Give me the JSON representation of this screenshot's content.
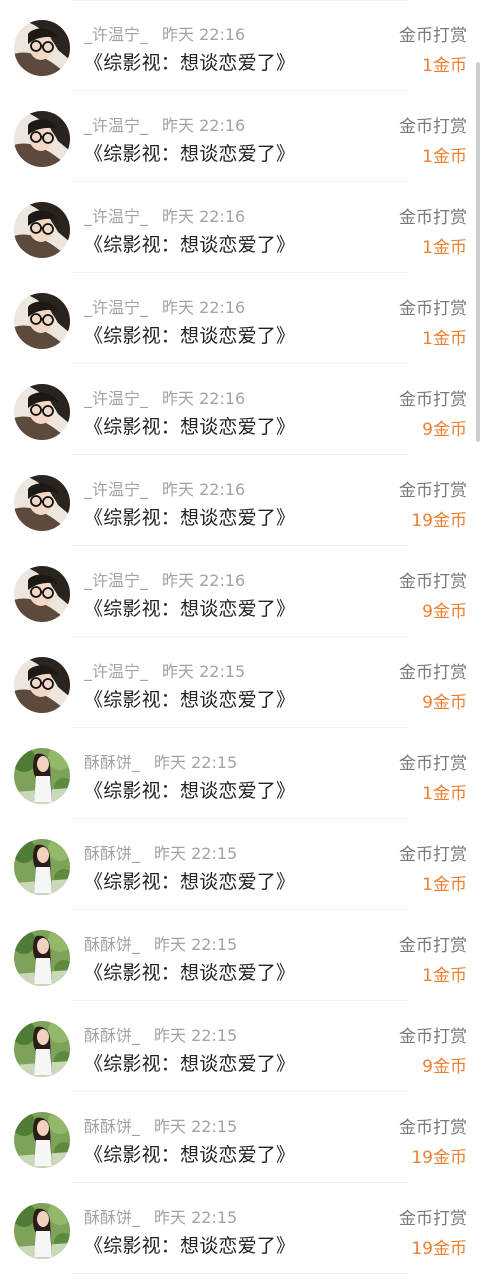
{
  "reward_list": {
    "items": [
      {
        "user": "_许温宁_",
        "time": "昨天 22:16",
        "book": "《综影视：想谈恋爱了》",
        "reward_label": "金币打赏",
        "amount": "1金币",
        "avatar": "glasses"
      },
      {
        "user": "_许温宁_",
        "time": "昨天 22:16",
        "book": "《综影视：想谈恋爱了》",
        "reward_label": "金币打赏",
        "amount": "1金币",
        "avatar": "glasses"
      },
      {
        "user": "_许温宁_",
        "time": "昨天 22:16",
        "book": "《综影视：想谈恋爱了》",
        "reward_label": "金币打赏",
        "amount": "1金币",
        "avatar": "glasses"
      },
      {
        "user": "_许温宁_",
        "time": "昨天 22:16",
        "book": "《综影视：想谈恋爱了》",
        "reward_label": "金币打赏",
        "amount": "1金币",
        "avatar": "glasses"
      },
      {
        "user": "_许温宁_",
        "time": "昨天 22:16",
        "book": "《综影视：想谈恋爱了》",
        "reward_label": "金币打赏",
        "amount": "9金币",
        "avatar": "glasses"
      },
      {
        "user": "_许温宁_",
        "time": "昨天 22:16",
        "book": "《综影视：想谈恋爱了》",
        "reward_label": "金币打赏",
        "amount": "19金币",
        "avatar": "glasses"
      },
      {
        "user": "_许温宁_",
        "time": "昨天 22:16",
        "book": "《综影视：想谈恋爱了》",
        "reward_label": "金币打赏",
        "amount": "9金币",
        "avatar": "glasses"
      },
      {
        "user": "_许温宁_",
        "time": "昨天 22:15",
        "book": "《综影视：想谈恋爱了》",
        "reward_label": "金币打赏",
        "amount": "9金币",
        "avatar": "glasses"
      },
      {
        "user": "酥酥饼_",
        "time": "昨天 22:15",
        "book": "《综影视：想谈恋爱了》",
        "reward_label": "金币打赏",
        "amount": "1金币",
        "avatar": "garden"
      },
      {
        "user": "酥酥饼_",
        "time": "昨天 22:15",
        "book": "《综影视：想谈恋爱了》",
        "reward_label": "金币打赏",
        "amount": "1金币",
        "avatar": "garden"
      },
      {
        "user": "酥酥饼_",
        "time": "昨天 22:15",
        "book": "《综影视：想谈恋爱了》",
        "reward_label": "金币打赏",
        "amount": "1金币",
        "avatar": "garden"
      },
      {
        "user": "酥酥饼_",
        "time": "昨天 22:15",
        "book": "《综影视：想谈恋爱了》",
        "reward_label": "金币打赏",
        "amount": "9金币",
        "avatar": "garden"
      },
      {
        "user": "酥酥饼_",
        "time": "昨天 22:15",
        "book": "《综影视：想谈恋爱了》",
        "reward_label": "金币打赏",
        "amount": "19金币",
        "avatar": "garden"
      },
      {
        "user": "酥酥饼_",
        "time": "昨天 22:15",
        "book": "《综影视：想谈恋爱了》",
        "reward_label": "金币打赏",
        "amount": "19金币",
        "avatar": "garden"
      }
    ]
  },
  "colors": {
    "amount": "#ef7f30",
    "title": "#222222",
    "meta": "#a3a3a3"
  }
}
